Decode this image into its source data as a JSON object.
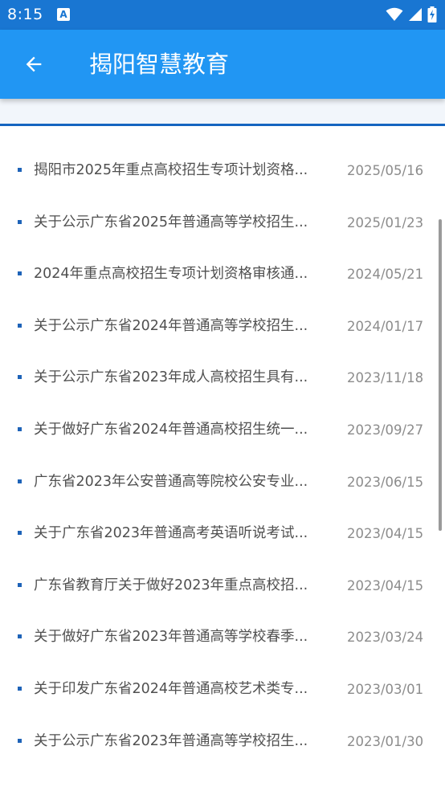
{
  "status_bar": {
    "time": "8:15",
    "notification_icon": "A"
  },
  "app_bar": {
    "title": "揭阳智慧教育",
    "back_icon": "arrow-left"
  },
  "news": [
    {
      "title": "揭阳市2025年重点高校招生专项计划资格...",
      "date": "2025/05/16"
    },
    {
      "title": "关于公示广东省2025年普通高等学校招生...",
      "date": "2025/01/23"
    },
    {
      "title": "2024年重点高校招生专项计划资格审核通...",
      "date": "2024/05/21"
    },
    {
      "title": "关于公示广东省2024年普通高等学校招生...",
      "date": "2024/01/17"
    },
    {
      "title": "关于公示广东省2023年成人高校招生具有...",
      "date": "2023/11/18"
    },
    {
      "title": "关于做好广东省2024年普通高校招生统一...",
      "date": "2023/09/27"
    },
    {
      "title": "广东省2023年公安普通高等院校公安专业...",
      "date": "2023/06/15"
    },
    {
      "title": "关于广东省2023年普通高考英语听说考试...",
      "date": "2023/04/15"
    },
    {
      "title": "广东省教育厅关于做好2023年重点高校招...",
      "date": "2023/04/15"
    },
    {
      "title": "关于做好广东省2023年普通高等学校春季...",
      "date": "2023/03/24"
    },
    {
      "title": "关于印发广东省2024年普通高校艺术类专...",
      "date": "2023/03/01"
    },
    {
      "title": "关于公示广东省2023年普通高等学校招生...",
      "date": "2023/01/30"
    }
  ],
  "colors": {
    "status_bar": "#1976d2",
    "app_bar": "#2196f3",
    "accent_line": "#1565c0",
    "bullet": "#1e63b8"
  }
}
